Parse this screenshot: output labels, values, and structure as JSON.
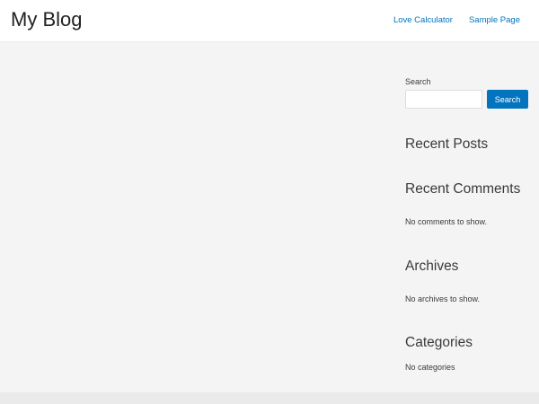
{
  "header": {
    "site_title": "My Blog",
    "nav": [
      "Love Calculator",
      "Sample Page"
    ]
  },
  "sidebar": {
    "search": {
      "label": "Search",
      "value": "",
      "placeholder": "",
      "button_label": "Search"
    },
    "recent_posts": {
      "title": "Recent Posts"
    },
    "recent_comments": {
      "title": "Recent Comments",
      "empty_text": "No comments to show."
    },
    "archives": {
      "title": "Archives",
      "empty_text": "No archives to show."
    },
    "categories": {
      "title": "Categories",
      "empty_text": "No categories"
    }
  },
  "colors": {
    "accent": "#0274be",
    "background": "#f4f4f4",
    "header_background": "#ffffff"
  }
}
